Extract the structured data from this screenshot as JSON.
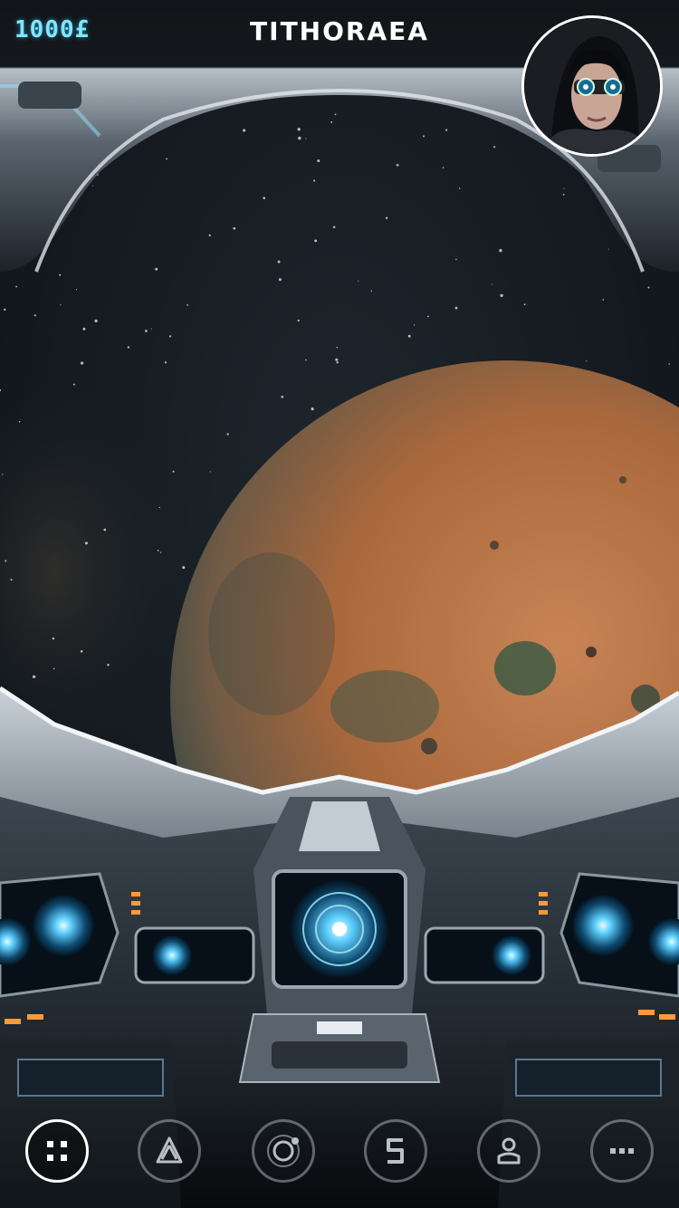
{
  "header": {
    "credits": "1000£",
    "title": "TITHORAEA"
  },
  "avatar": {
    "icon": "pilot-avatar-icon"
  },
  "nav": [
    {
      "icon": "grid-menu-icon",
      "active": true
    },
    {
      "icon": "ship-icon",
      "active": false
    },
    {
      "icon": "planet-orbit-icon",
      "active": false
    },
    {
      "icon": "currency-icon",
      "active": false
    },
    {
      "icon": "profile-icon",
      "active": false
    },
    {
      "icon": "more-icon",
      "active": false
    }
  ],
  "colors": {
    "accent": "#7fe6ff",
    "planet": "#b8703e",
    "space": "#1a2128"
  }
}
